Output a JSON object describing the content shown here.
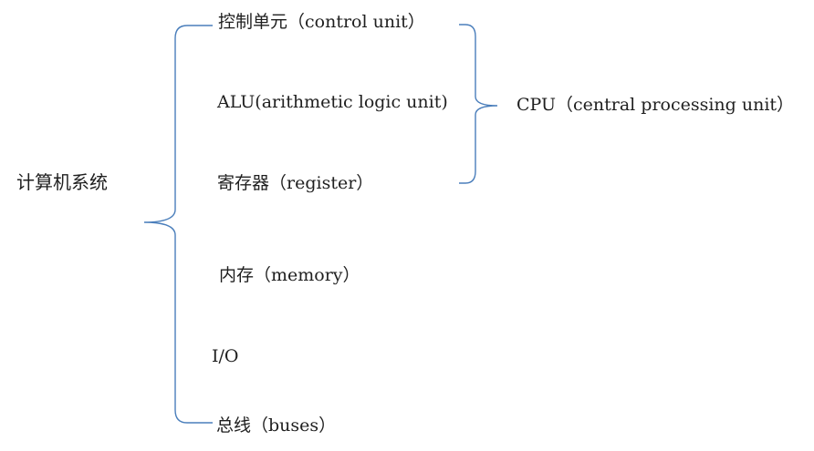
{
  "root": {
    "label": "计算机系统"
  },
  "components": [
    {
      "label": "控制单元（control unit）"
    },
    {
      "label": "ALU(arithmetic logic unit)"
    },
    {
      "label": "寄存器（register）"
    },
    {
      "label": "内存（memory）"
    },
    {
      "label": "I/O"
    },
    {
      "label": "总线（buses）"
    }
  ],
  "group": {
    "label": "CPU（central processing unit）"
  },
  "colors": {
    "bracket": "#4a7ebb",
    "text": "#1f1f1f",
    "background": "#ffffff"
  }
}
